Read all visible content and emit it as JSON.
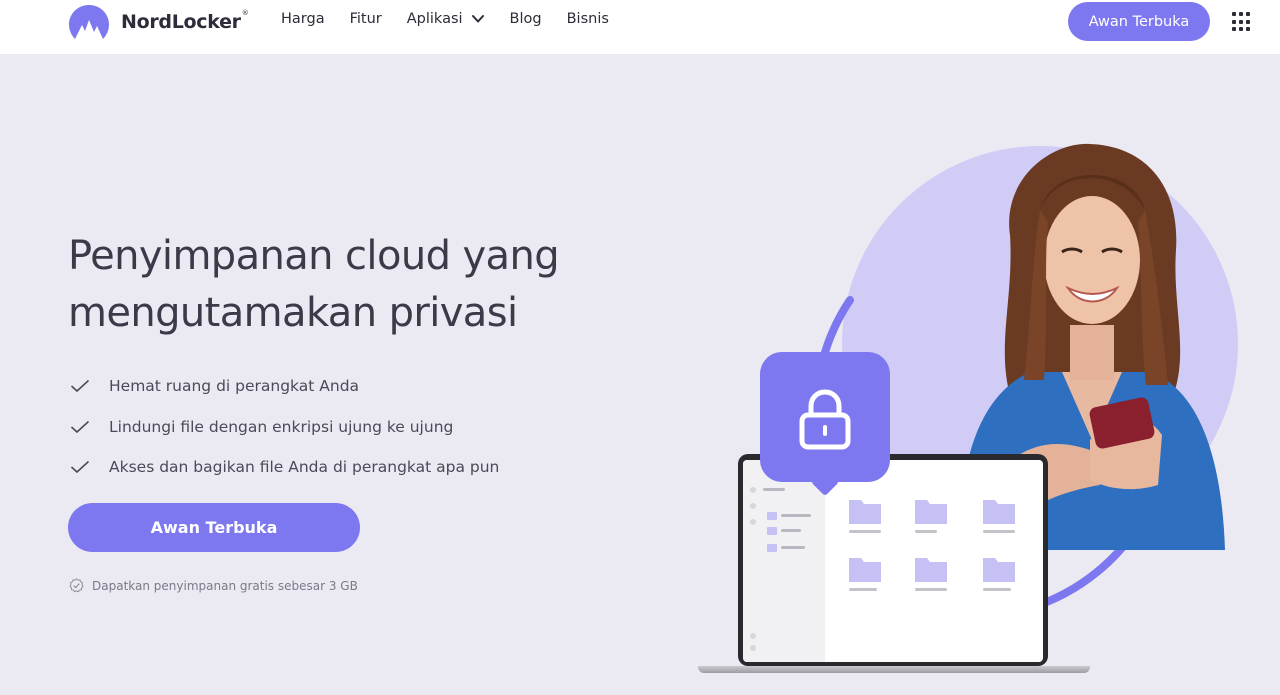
{
  "header": {
    "logo_text": "NordLocker",
    "logo_mark": "®",
    "nav": [
      {
        "label": "Harga"
      },
      {
        "label": "Fitur"
      },
      {
        "label": "Aplikasi",
        "has_dropdown": true
      },
      {
        "label": "Blog"
      },
      {
        "label": "Bisnis"
      }
    ],
    "cta_label": "Awan Terbuka",
    "apps_icon": "grid-dots-icon"
  },
  "hero": {
    "title_line1": "Penyimpanan cloud yang",
    "title_line2": "mengutamakan privasi",
    "features": [
      {
        "icon": "checkmark-icon",
        "text": "Hemat ruang di perangkat Anda"
      },
      {
        "icon": "checkmark-icon",
        "text": "Lindungi file dengan enkripsi ujung ke ujung"
      },
      {
        "icon": "checkmark-icon",
        "text": "Akses dan bagikan file Anda di perangkat apa pun"
      }
    ],
    "cta_label": "Awan Terbuka",
    "free_note": "Dapatkan penyimpanan gratis sebesar 3 GB",
    "free_note_icon": "check-badge-icon"
  },
  "colors": {
    "accent": "#7e78f0",
    "background": "#ebeaf3",
    "circle": "#d0ccf6",
    "text_dark": "#3a3a48"
  }
}
